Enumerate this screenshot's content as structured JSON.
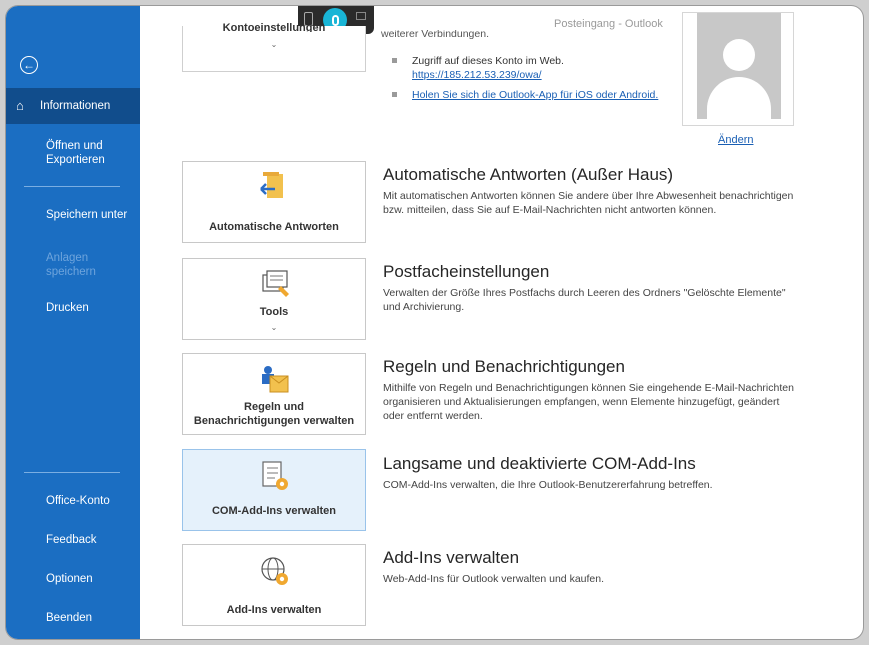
{
  "window": {
    "title": "Posteingang - Outlook"
  },
  "sidebar": {
    "back_icon": "back-arrow-icon",
    "items": [
      {
        "label": "Informationen",
        "icon": "home-icon"
      },
      {
        "label": "Öffnen und Exportieren"
      },
      {
        "label": "Speichern unter"
      },
      {
        "label": "Anlagen speichern"
      },
      {
        "label": "Drucken"
      },
      {
        "label": "Office-Konto"
      },
      {
        "label": "Feedback"
      },
      {
        "label": "Optionen"
      },
      {
        "label": "Beenden"
      }
    ]
  },
  "account": {
    "settings_label": "Kontoeinstellungen",
    "partial_text": "weiterer Verbindungen.",
    "bullets": [
      {
        "text": "Zugriff auf dieses Konto im Web.",
        "link": "https://185.212.53.239/owa/"
      },
      {
        "link": "Holen Sie sich die Outlook-App für iOS oder Android."
      }
    ],
    "change_link": "Ändern"
  },
  "cards": [
    {
      "label": "Automatische Antworten",
      "icon": "auto-reply-icon",
      "title": "Automatische Antworten (Außer Haus)",
      "desc": "Mit automatischen Antworten können Sie andere über Ihre Abwesenheit benachrichtigen bzw. mitteilen, dass Sie auf E-Mail-Nachrichten nicht antworten können."
    },
    {
      "label": "Tools",
      "icon": "tools-icon",
      "title": "Postfacheinstellungen",
      "desc": "Verwalten der Größe Ihres Postfachs durch Leeren des Ordners \"Gelöschte Elemente\" und Archivierung."
    },
    {
      "label_line1": "Regeln und",
      "label_line2": "Benachrichtigungen verwalten",
      "icon": "rules-alerts-icon",
      "title": "Regeln und Benachrichtigungen",
      "desc": "Mithilfe von Regeln und Benachrichtigungen können Sie eingehende E-Mail-Nachrichten organisieren und Aktualisierungen empfangen, wenn Elemente hinzugefügt, geändert oder entfernt werden."
    },
    {
      "label": "COM-Add-Ins verwalten",
      "icon": "com-addins-icon",
      "title": "Langsame und deaktivierte COM-Add-Ins",
      "desc": "COM-Add-Ins verwalten, die Ihre Outlook-Benutzererfahrung betreffen."
    },
    {
      "label": "Add-Ins verwalten",
      "icon": "globe-gear-icon",
      "title": "Add-Ins verwalten",
      "desc": "Web-Add-Ins für Outlook verwalten und kaufen."
    }
  ]
}
